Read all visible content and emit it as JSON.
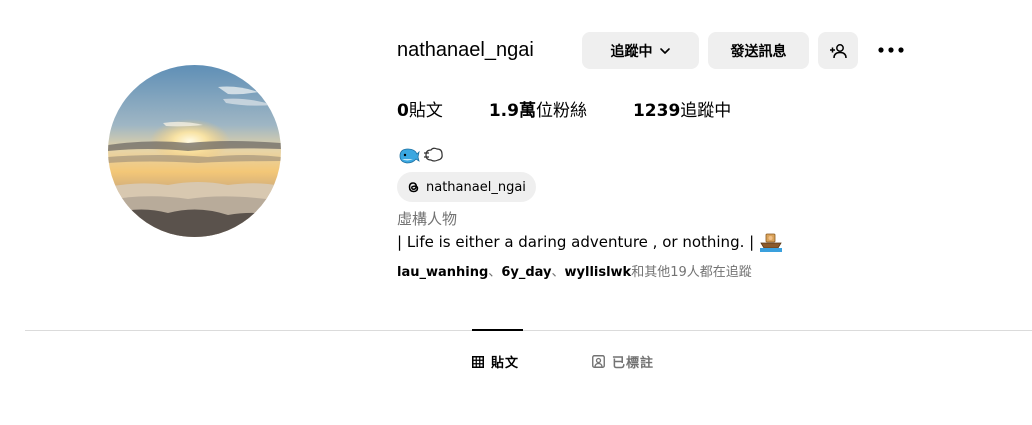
{
  "profile": {
    "username": "nathanael_ngai",
    "category": "虛構人物",
    "bio": "| Life is either a daring adventure , or nothing. |"
  },
  "actions": {
    "following_label": "追蹤中",
    "message_label": "發送訊息"
  },
  "stats": {
    "posts_count": "0",
    "posts_label": "貼文",
    "followers_count": "1.9萬",
    "followers_label": "位粉絲",
    "following_count": "1239",
    "following_label": "追蹤中"
  },
  "threads": {
    "handle": "nathanael_ngai"
  },
  "followed_by": {
    "users": [
      "lau_wanhing",
      "6y_day",
      "wyllislwk"
    ],
    "separator": "、",
    "suffix": "和其他19人都在追蹤"
  },
  "tabs": [
    {
      "label": "貼文",
      "icon": "grid-icon",
      "active": true
    },
    {
      "label": "已標註",
      "icon": "tagged-icon",
      "active": false
    }
  ],
  "icons": {
    "chevron": "chevron-down-icon",
    "add_user": "add-user-icon",
    "more": "more-options-icon",
    "threads": "threads-icon",
    "emoji_1": "whale-emoji",
    "emoji_2": "dash-emoji",
    "emoji_3": "boat-emoji"
  },
  "colors": {
    "button_bg": "#efefef",
    "secondary_text": "#737373",
    "divider": "#dbdbdb"
  }
}
